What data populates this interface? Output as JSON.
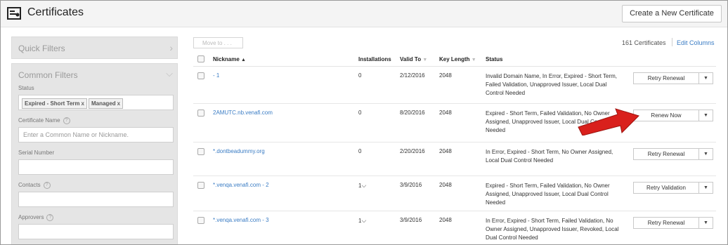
{
  "header": {
    "title": "Certificates",
    "create_button": "Create a New Certificate"
  },
  "sidebar": {
    "quick_filters": "Quick Filters",
    "common_filters": "Common Filters",
    "status_label": "Status",
    "status_tags": [
      "Expired - Short Term",
      "Managed"
    ],
    "tag_close": "x",
    "cert_name_label": "Certificate Name",
    "cert_name_placeholder": "Enter a Common Name or Nickname.",
    "serial_label": "Serial Number",
    "contacts_label": "Contacts",
    "approvers_label": "Approvers",
    "help_glyph": "?"
  },
  "toolbar": {
    "move_to": "Move to . . .",
    "count": "161 Certificates",
    "edit_columns": "Edit Columns"
  },
  "table": {
    "columns": [
      "Nickname",
      "Installations",
      "Valid To",
      "Key Length",
      "Status"
    ],
    "rows": [
      {
        "nickname": "- 1",
        "installations": "0",
        "valid_to": "2/12/2016",
        "key_length": "2048",
        "status": "Invalid Domain Name, In Error, Expired - Short Term, Failed Validation, Unapproved Issuer, Local Dual Control Needed",
        "action": "Retry Renewal"
      },
      {
        "nickname": "2AMUTC.nb.venafi.com",
        "installations": "0",
        "valid_to": "8/20/2016",
        "key_length": "2048",
        "status": "Expired - Short Term, Failed Validation, No Owner Assigned, Unapproved Issuer, Local Dual Control Needed",
        "action": "Renew Now"
      },
      {
        "nickname": "*.dontbeadummy.org",
        "installations": "0",
        "valid_to": "2/20/2016",
        "key_length": "2048",
        "status": "In Error, Expired - Short Term, No Owner Assigned, Local Dual Control Needed",
        "action": "Retry Renewal"
      },
      {
        "nickname": "*.venqa.venafi.com - 2",
        "installations": "1",
        "valid_to": "3/9/2016",
        "key_length": "2048",
        "status": "Expired - Short Term, Failed Validation, No Owner Assigned, Unapproved Issuer, Local Dual Control Needed",
        "action": "Retry Validation"
      },
      {
        "nickname": "*.venqa.venafi.com - 3",
        "installations": "1",
        "valid_to": "3/9/2016",
        "key_length": "2048",
        "status": "In Error, Expired - Short Term, Failed Validation, No Owner Assigned, Unapproved Issuer, Revoked, Local Dual Control Needed",
        "action": "Retry Renewal"
      }
    ]
  },
  "colors": {
    "link": "#3a7cc4",
    "arrow": "#d9201c"
  }
}
